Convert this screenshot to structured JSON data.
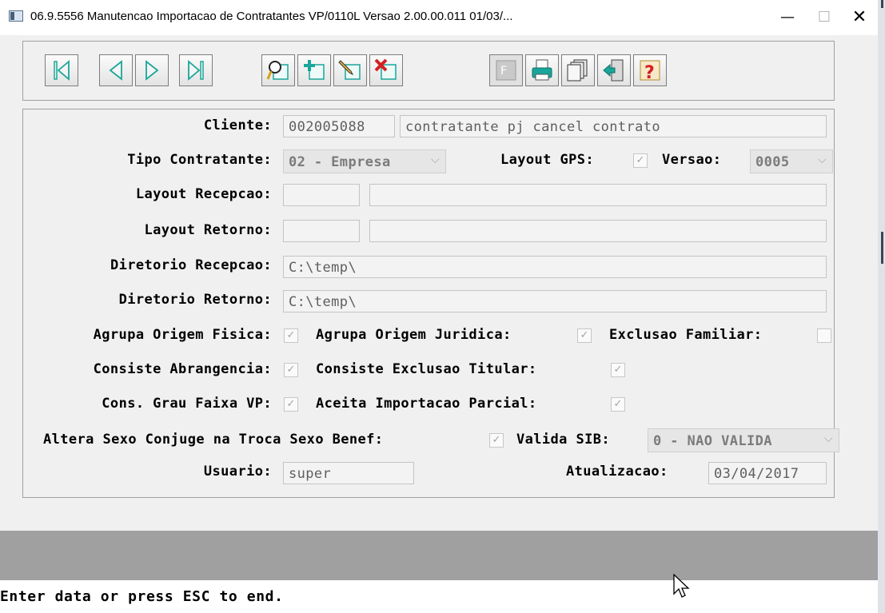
{
  "window": {
    "title": "06.9.5556 Manutencao  Importacao de Contratantes  VP/0110L Versao 2.00.00.011 01/03/...",
    "minimize_glyph": "—",
    "maximize_glyph": "☐",
    "close_glyph": "✕"
  },
  "toolbar": {
    "buttons": [
      {
        "name": "first-record",
        "icon": "first-icon",
        "enabled": true
      },
      {
        "name": "previous-record",
        "icon": "prev-icon",
        "enabled": true
      },
      {
        "name": "next-record",
        "icon": "next-icon",
        "enabled": true
      },
      {
        "name": "last-record",
        "icon": "last-icon",
        "enabled": true
      },
      {
        "name": "search",
        "icon": "magnifier-icon",
        "enabled": true
      },
      {
        "name": "add-record",
        "icon": "add-icon",
        "enabled": true
      },
      {
        "name": "edit-record",
        "icon": "pencil-icon",
        "enabled": true
      },
      {
        "name": "delete-record",
        "icon": "delete-icon",
        "enabled": true
      },
      {
        "name": "filter",
        "icon": "filter-icon",
        "enabled": false
      },
      {
        "name": "print",
        "icon": "printer-icon",
        "enabled": true
      },
      {
        "name": "copy",
        "icon": "copy-icon",
        "enabled": true
      },
      {
        "name": "exit",
        "icon": "exit-door-icon",
        "enabled": true
      },
      {
        "name": "help",
        "icon": "help-icon",
        "enabled": true
      }
    ]
  },
  "form": {
    "cliente": {
      "label": "Cliente:",
      "code": "002005088",
      "name": "contratante pj cancel contrato"
    },
    "tipo_contratante": {
      "label": "Tipo Contratante:",
      "value": "02 - Empresa"
    },
    "layout_gps": {
      "label": "Layout GPS:",
      "checked": true
    },
    "versao": {
      "label": "Versao:",
      "value": "0005"
    },
    "layout_recepcao": {
      "label": "Layout Recepcao:",
      "code": "",
      "desc": ""
    },
    "layout_retorno": {
      "label": "Layout Retorno:",
      "code": "",
      "desc": ""
    },
    "diretorio_recepcao": {
      "label": "Diretorio Recepcao:",
      "value": "C:\\temp\\"
    },
    "diretorio_retorno": {
      "label": "Diretorio Retorno:",
      "value": "C:\\temp\\"
    },
    "agrupa_origem_fisica": {
      "label": "Agrupa Origem Fisica:",
      "checked": true
    },
    "agrupa_origem_juridica": {
      "label": "Agrupa Origem Juridica:",
      "checked": true
    },
    "exclusao_familiar": {
      "label": "Exclusao Familiar:",
      "checked": false
    },
    "consiste_abrangencia": {
      "label": "Consiste Abrangencia:",
      "checked": true
    },
    "consiste_exclusao_titular": {
      "label": "Consiste Exclusao Titular:",
      "checked": true
    },
    "cons_grau_faixa_vp": {
      "label": "Cons. Grau Faixa VP:",
      "checked": true
    },
    "aceita_importacao_parcial": {
      "label": "Aceita Importacao Parcial:",
      "checked": true
    },
    "altera_sexo_conjuge": {
      "label": "Altera Sexo Conjuge na Troca Sexo Benef:",
      "checked": true
    },
    "valida_sib": {
      "label": "Valida SIB:",
      "value": "0 - NAO VALIDA"
    },
    "usuario": {
      "label": "Usuario:",
      "value": "super"
    },
    "atualizacao": {
      "label": "Atualizacao:",
      "value": "03/04/2017"
    }
  },
  "status": {
    "message": "Enter data or press ESC to end."
  },
  "glyphs": {
    "check": "✓",
    "dropdown": "⌵"
  },
  "colors": {
    "field_bg": "#f3f3f3",
    "panel_bg": "#f0f0f0",
    "status_band": "#a0a0a0",
    "icon_teal": "#1aa69a",
    "icon_red": "#d42020"
  }
}
